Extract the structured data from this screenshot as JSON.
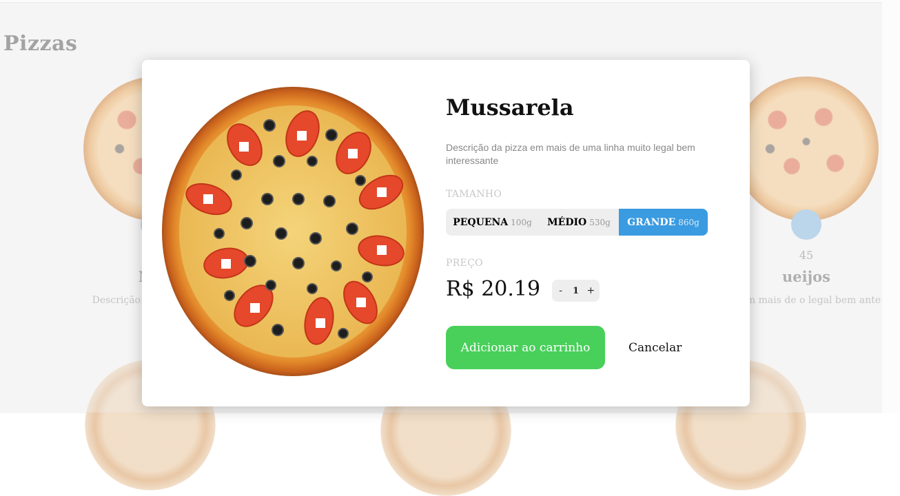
{
  "page": {
    "section_title": "Pizzas"
  },
  "background_cards": {
    "left": {
      "price": "R$",
      "name": "Mus",
      "desc": "Descrição da uma linha m inter"
    },
    "right": {
      "price": "45",
      "name": "ueijos",
      "desc": "a em mais de o legal bem ante"
    }
  },
  "modal": {
    "title": "Mussarela",
    "description": "Descrição da pizza em mais de uma linha muito legal bem interessante",
    "size_label": "TAMANHO",
    "sizes": [
      {
        "name": "PEQUENA",
        "weight": "100g",
        "selected": false
      },
      {
        "name": "MÉDIO",
        "weight": "530g",
        "selected": false
      },
      {
        "name": "GRANDE",
        "weight": "860g",
        "selected": true
      }
    ],
    "price_label": "PREÇO",
    "price": "R$ 20.19",
    "quantity": {
      "minus": "-",
      "value": "1",
      "plus": "+"
    },
    "add_button": "Adicionar ao carrinho",
    "cancel_button": "Cancelar"
  },
  "colors": {
    "accent_blue": "#3a9be0",
    "add_green": "#48d05a"
  }
}
